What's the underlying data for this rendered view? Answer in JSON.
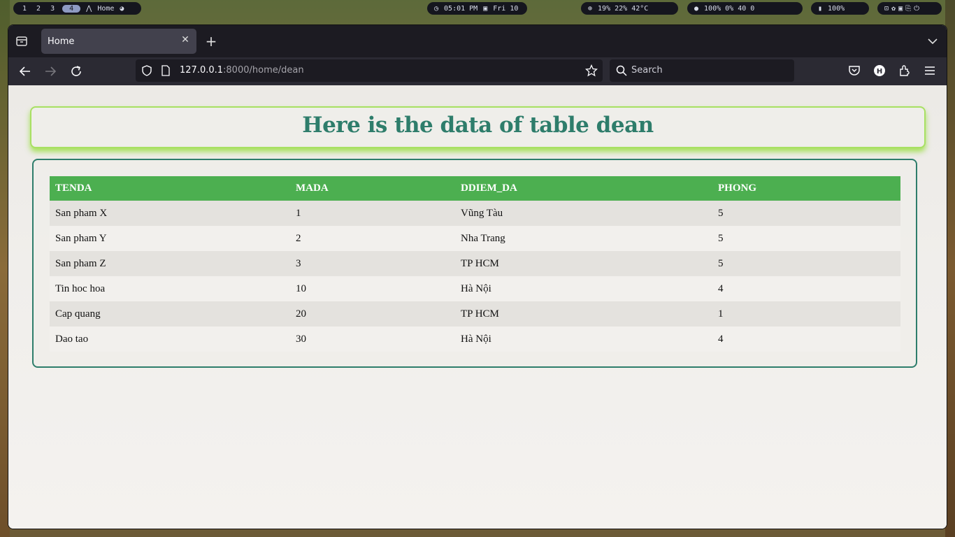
{
  "topbar": {
    "workspaces": [
      "1",
      "2",
      "3",
      "4"
    ],
    "window_title": "Home",
    "clock": "05:01 PM",
    "date": "Fri 10",
    "system_stats": "19%  22%  42°C",
    "audio_stats": "100%  0%  40  0",
    "battery": "100%"
  },
  "browser": {
    "tab_title": "Home",
    "url_host": "127.0.0.1",
    "url_rest": ":8000/home/dean",
    "search_placeholder": "Search"
  },
  "page": {
    "heading": "Here is the data of table dean",
    "columns": [
      "TENDA",
      "MADA",
      "DDIEM_DA",
      "PHONG"
    ],
    "rows": [
      [
        "San pham X",
        "1",
        "Vũng Tàu",
        "5"
      ],
      [
        "San pham Y",
        "2",
        "Nha Trang",
        "5"
      ],
      [
        "San pham Z",
        "3",
        "TP HCM",
        "5"
      ],
      [
        "Tin hoc hoa",
        "10",
        "Hà Nội",
        "4"
      ],
      [
        "Cap quang",
        "20",
        "TP HCM",
        "1"
      ],
      [
        "Dao tao",
        "30",
        "Hà Nội",
        "4"
      ]
    ]
  },
  "colors": {
    "header_green": "#4caf50",
    "heading_teal": "#2e7d6b",
    "glow_green": "#a8e063"
  }
}
